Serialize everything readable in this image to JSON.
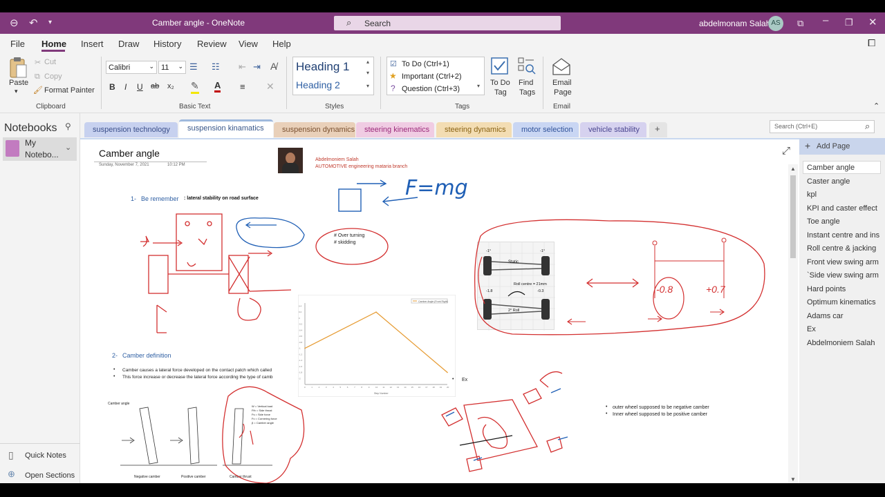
{
  "titlebar": {
    "title": "Camber angle  -  OneNote",
    "search_placeholder": "Search",
    "user_name": "abdelmonam Salah",
    "user_initials": "AS"
  },
  "menu": [
    "File",
    "Home",
    "Insert",
    "Draw",
    "History",
    "Review",
    "View",
    "Help"
  ],
  "ribbon": {
    "clipboard": {
      "paste": "Paste",
      "cut": "Cut",
      "copy": "Copy",
      "format_painter": "Format Painter",
      "label": "Clipboard"
    },
    "basic_text": {
      "font": "Calibri",
      "size": "11",
      "label": "Basic Text"
    },
    "styles": {
      "heading1": "Heading 1",
      "heading2": "Heading 2",
      "label": "Styles"
    },
    "tags": {
      "todo": "To Do (Ctrl+1)",
      "important": "Important (Ctrl+2)",
      "question": "Question (Ctrl+3)",
      "todo_tag": [
        "To Do",
        "Tag"
      ],
      "find_tags": [
        "Find",
        "Tags"
      ],
      "label": "Tags"
    },
    "email": {
      "line1": "Email",
      "line2": "Page",
      "label": "Email"
    }
  },
  "notebooks": {
    "title": "Notebooks",
    "current": [
      "My",
      "Notebo..."
    ],
    "quick_notes": "Quick Notes",
    "open_sections": "Open Sections"
  },
  "sections": [
    {
      "label": "suspension technology",
      "color": "#c7d1ef"
    },
    {
      "label": "suspension kinamatics",
      "color": "#cbd9ec"
    },
    {
      "label": "suspension dynamics",
      "color": "#e9d0b9"
    },
    {
      "label": "steering kinematics",
      "color": "#f0cce3"
    },
    {
      "label": "steering dynamics",
      "color": "#f3ddb3"
    },
    {
      "label": "motor selection",
      "color": "#c9d6f3"
    },
    {
      "label": "vehicle stability",
      "color": "#d6d2ef"
    }
  ],
  "page": {
    "title": "Camber angle",
    "date": "Sunday, November 7, 2021",
    "time": "10:12 PM",
    "author_name": "Abdelmoniem Salah",
    "author_org": "AUTOMOTIVE engineering mataria branch",
    "item1_num": "1-",
    "item1_head": "Be remember",
    "item1_rest": ": lateral stability on road surface",
    "overturning": "# Over turning",
    "skidding": "# skidding",
    "item2_num": "2-",
    "item2_head": "Camber definition",
    "bullet1": "Camber causes a lateral force developed on the contact patch which called",
    "bullet2": "This force increase or decrease the lateral force according the type of camb",
    "ex": "Ex",
    "outer": "outer wheel supposed to be negative camber",
    "inner": "Inner wheel supposed to be positive camber",
    "chart_legend": "Camber Angle (Front Right)",
    "static": "Static",
    "roll_centre": "Roll centre = 21mm",
    "roll_2": "2° Roll",
    "m18": "-1.8",
    "m03": "-0.3",
    "m1a": "-1°",
    "m1b": "-1°",
    "camber_lbl": "Camber angle",
    "neg_camber": "Negative camber",
    "pos_camber": "Positive camber",
    "camber_thrust": "Camber thrust",
    "legend_w": "W  = Vertical load",
    "legend_fth": "Fth = Side thrust",
    "legend_fs": "Fs  = Side force",
    "legend_fc": "Fc  = Cornering force",
    "legend_b": "β   = Camber angle"
  },
  "search_pages": "Search (Ctrl+E)",
  "add_page": "Add Page",
  "pages": [
    "Camber angle",
    "Caster angle",
    "kpl",
    "KPI and caster effect",
    "Toe angle",
    "Instant centre and ins",
    "Roll centre & jacking",
    "Front view swing arm",
    "`Side view swing arm",
    "Hard points",
    "Optimum kinematics",
    "Adams car",
    "Ex",
    "Abdelmoniem Salah"
  ],
  "chart_data": {
    "type": "line",
    "title": "",
    "series": [
      {
        "name": "Camber Angle (Front Right)",
        "x": [
          0,
          10,
          20
        ],
        "y": [
          -1.0,
          0.2,
          -1.8
        ]
      }
    ],
    "xlim": [
      0,
      20
    ],
    "ylim": [
      -2.2,
      0.5
    ],
    "xlabel": "Step Number",
    "ylabel": ""
  }
}
